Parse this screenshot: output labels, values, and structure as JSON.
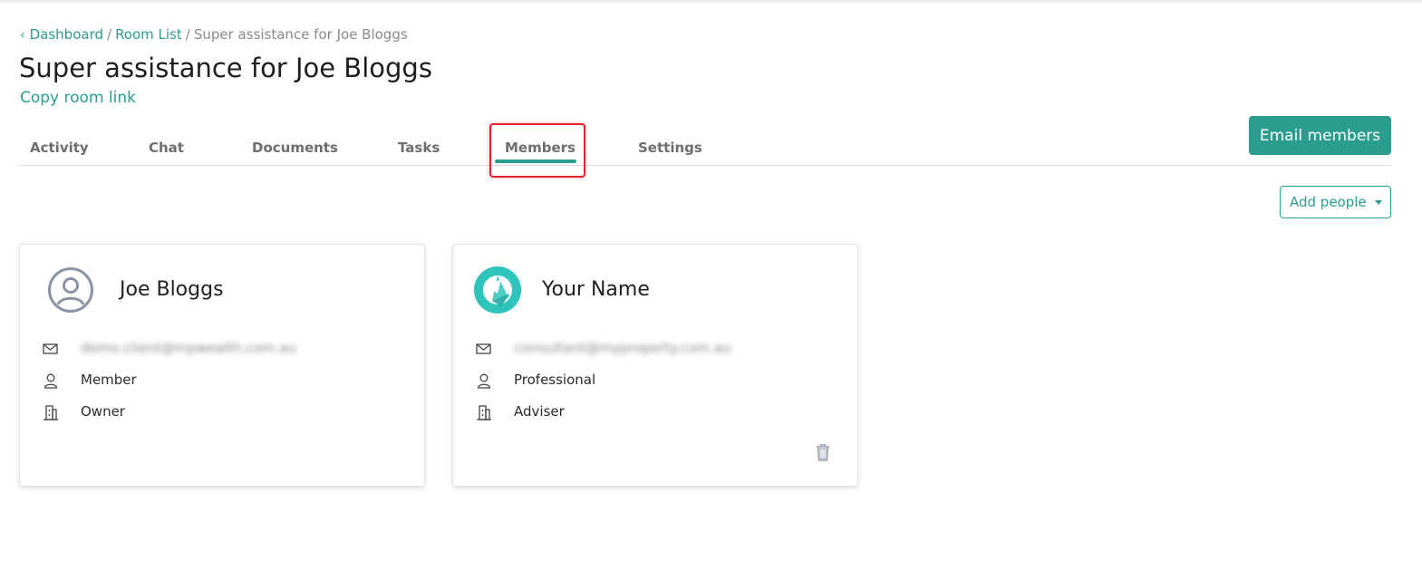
{
  "breadcrumb": {
    "items": [
      "Dashboard",
      "Room List"
    ],
    "separator": "/",
    "current": "Super assistance for Joe Bloggs"
  },
  "page": {
    "title": "Super assistance for Joe Bloggs",
    "copy_link": "Copy room link"
  },
  "tabs": [
    {
      "label": "Activity",
      "active": false
    },
    {
      "label": "Chat",
      "active": false
    },
    {
      "label": "Documents",
      "active": false
    },
    {
      "label": "Tasks",
      "active": false
    },
    {
      "label": "Members",
      "active": true
    },
    {
      "label": "Settings",
      "active": false
    }
  ],
  "actions": {
    "email_members": "Email members",
    "add_people": "Add people"
  },
  "members": [
    {
      "name": "Joe Bloggs",
      "avatar": "user-circle-icon",
      "email": "demo.client@mpwealth.com.au",
      "role": "Member",
      "org_role": "Owner",
      "deletable": false
    },
    {
      "name": "Your Name",
      "avatar": "brand-logo-icon",
      "email": "consultant@myproperty.com.au",
      "role": "Professional",
      "org_role": "Adviser",
      "deletable": true
    }
  ],
  "colors": {
    "accent": "#2a9d8f",
    "highlight": "#e3242b",
    "text": "#2b2b2b",
    "muted": "#6e6e6e"
  }
}
